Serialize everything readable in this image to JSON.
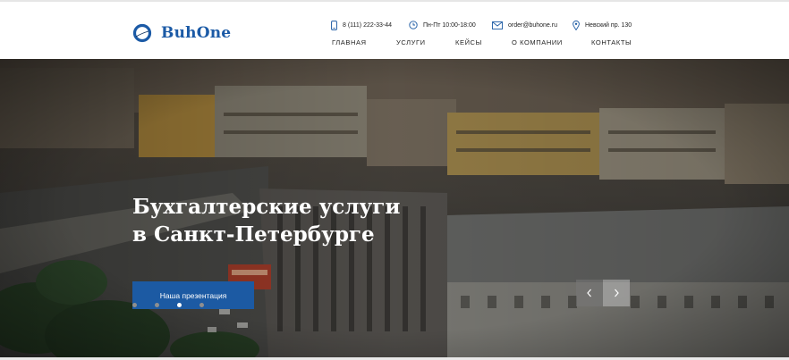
{
  "brand": {
    "name": "BuhOne"
  },
  "contacts": {
    "phone": "8 (111) 222-33-44",
    "hours": "Пн-Пт 10:00-18:00",
    "email": "order@buhone.ru",
    "address": "Невский пр. 130"
  },
  "nav": {
    "items": [
      "ГЛАВНАЯ",
      "УСЛУГИ",
      "КЕЙСЫ",
      "О КОМПАНИИ",
      "КОНТАКТЫ"
    ]
  },
  "hero": {
    "title": "Бухгалтерские услуги\nв Санкт-Петербурге",
    "cta_label": "Наша презентация",
    "slider": {
      "total": 4,
      "active": 3
    }
  },
  "colors": {
    "accent": "#1c5aa3",
    "brand_text": "#1b5aa6"
  },
  "icons": {
    "phone": "phone-icon",
    "hours": "clock-icon",
    "email": "mail-icon",
    "address": "location-pin-icon",
    "prev": "chevron-left-icon",
    "next": "chevron-right-icon"
  }
}
